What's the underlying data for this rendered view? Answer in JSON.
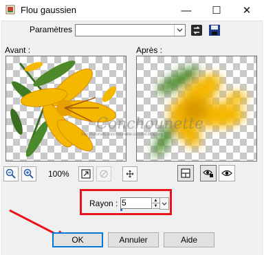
{
  "window": {
    "title": "Flou gaussien",
    "minimize": "—",
    "maximize": "☐",
    "close": "✕"
  },
  "params": {
    "label": "Paramètres :",
    "value": ""
  },
  "preview": {
    "before_label": "Avant :",
    "after_label": "Après :",
    "watermark": "Conchounette",
    "watermark_url": "http://tutoriels.conchounette.com/bd.blog.org"
  },
  "zoom": {
    "level": "100%"
  },
  "radius": {
    "label": "Rayon :",
    "value": "5"
  },
  "buttons": {
    "ok": "OK",
    "cancel": "Annuler",
    "help": "Aide"
  },
  "colors": {
    "highlight": "#e8141b",
    "accent": "#0078d7",
    "flower": "#f5b800"
  },
  "icons": [
    "picture-app-icon",
    "dropdown-arrow-icon",
    "load-preset-icon",
    "save-preset-icon",
    "zoom-out-icon",
    "zoom-in-icon",
    "fit-preview-icon",
    "restore-icon",
    "move-icon",
    "split-view-icon",
    "eye-lock-icon",
    "eye-icon"
  ]
}
